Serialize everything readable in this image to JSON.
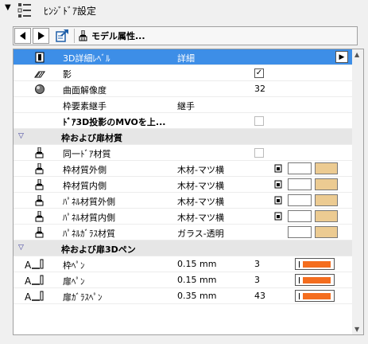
{
  "header": {
    "title": "ﾋﾝｼﾞﾄﾞｱ設定"
  },
  "toolbar": {
    "model_attr_label": "モデル属性..."
  },
  "colors": {
    "selection": "#3d8ee7",
    "group_bg": "#e6e6e6",
    "pen_color": "#f46d1e",
    "swatch_wood": "#eccb92"
  },
  "rows": [
    {
      "kind": "param",
      "name": "3D詳細ﾚﾍﾞﾙ",
      "value": "詳細",
      "control": "dropdown",
      "selected": true,
      "icon": "door-detail-icon"
    },
    {
      "kind": "param",
      "name": "影",
      "control": "checkbox",
      "checked": true,
      "icon": "shadow-icon"
    },
    {
      "kind": "param",
      "name": "曲面解像度",
      "number": "32",
      "icon": "sphere-icon"
    },
    {
      "kind": "param",
      "name": "枠要素継手",
      "value": "継手"
    },
    {
      "kind": "param",
      "name": "ﾄﾞｱ3D投影のMVOを上...",
      "control": "checkbox",
      "checked": false,
      "disabled": true,
      "bold": true
    },
    {
      "kind": "group",
      "name": "枠および扉材質"
    },
    {
      "kind": "param",
      "name": "同一ﾄﾞｱ材質",
      "control": "checkbox",
      "checked": false,
      "disabled": true,
      "icon": "brush-icon"
    },
    {
      "kind": "material",
      "name": "枠材質外側",
      "value": "木材-マツ横",
      "icon": "brush-icon"
    },
    {
      "kind": "material",
      "name": "枠材質内側",
      "value": "木材-マツ横",
      "icon": "brush-icon"
    },
    {
      "kind": "material",
      "name": "ﾊﾟﾈﾙ材質外側",
      "value": "木材-マツ横",
      "icon": "brush-icon"
    },
    {
      "kind": "material",
      "name": "ﾊﾟﾈﾙ材質内側",
      "value": "木材-マツ横",
      "icon": "brush-icon"
    },
    {
      "kind": "material",
      "name": "ﾊﾟﾈﾙｶﾞﾗｽ材質",
      "value": "ガラス-透明",
      "icon": "brush-icon",
      "no_preview_icon": true
    },
    {
      "kind": "group",
      "name": "枠および扉3Dペン"
    },
    {
      "kind": "pen",
      "name": "枠ﾍﾟﾝ",
      "value": "0.15 mm",
      "number": "3",
      "icon": "pen-icon"
    },
    {
      "kind": "pen",
      "name": "扉ﾍﾟﾝ",
      "value": "0.15 mm",
      "number": "3",
      "icon": "pen-icon"
    },
    {
      "kind": "pen",
      "name": "扉ｶﾞﾗｽﾍﾟﾝ",
      "value": "0.35 mm",
      "number": "43",
      "icon": "pen-icon"
    }
  ]
}
